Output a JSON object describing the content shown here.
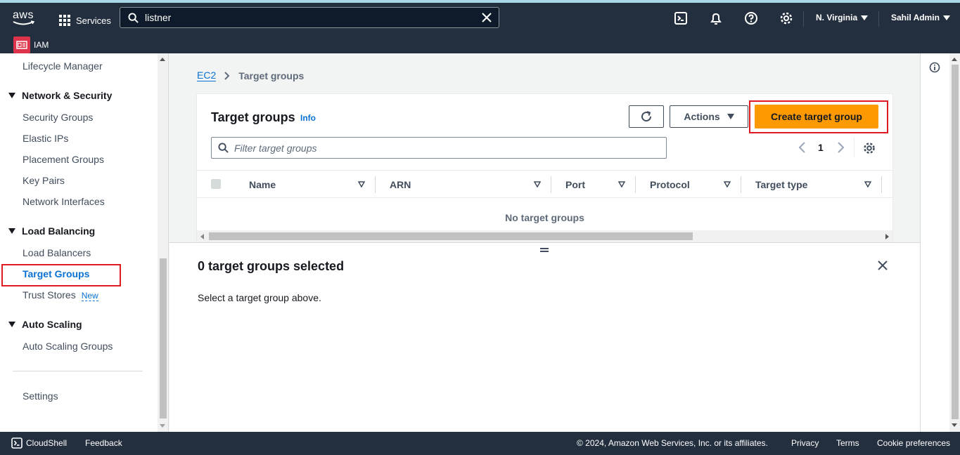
{
  "topbar": {
    "logo_text": "aws",
    "services_label": "Services",
    "search_value": "listner",
    "region_label": "N. Virginia",
    "user_label": "Sahil Admin",
    "pinned_service": "IAM"
  },
  "sidebar": {
    "items": [
      {
        "label": "Lifecycle Manager"
      },
      {
        "section": "Network & Security"
      },
      {
        "label": "Security Groups"
      },
      {
        "label": "Elastic IPs"
      },
      {
        "label": "Placement Groups"
      },
      {
        "label": "Key Pairs"
      },
      {
        "label": "Network Interfaces"
      },
      {
        "section": "Load Balancing"
      },
      {
        "label": "Load Balancers"
      },
      {
        "label": "Target Groups",
        "active": true
      },
      {
        "label": "Trust Stores",
        "badge": "New"
      },
      {
        "section": "Auto Scaling"
      },
      {
        "label": "Auto Scaling Groups"
      },
      {
        "label": "Settings"
      }
    ]
  },
  "breadcrumb": {
    "root": "EC2",
    "current": "Target groups"
  },
  "panel": {
    "title": "Target groups",
    "info": "Info",
    "actions_label": "Actions",
    "create_label": "Create target group",
    "filter_placeholder": "Filter target groups",
    "page_number": "1",
    "columns": [
      "Name",
      "ARN",
      "Port",
      "Protocol",
      "Target type"
    ],
    "empty_text": "No target groups"
  },
  "split_panel": {
    "title": "0 target groups selected",
    "body": "Select a target group above."
  },
  "footer": {
    "cloudshell": "CloudShell",
    "feedback": "Feedback",
    "copyright": "© 2024, Amazon Web Services, Inc. or its affiliates.",
    "privacy": "Privacy",
    "terms": "Terms",
    "cookies": "Cookie preferences"
  },
  "colors": {
    "nav_bg": "#232f3e",
    "primary_button": "#ff9900",
    "link": "#0972d3",
    "highlight_outline": "#e01a22"
  },
  "icons": [
    "grid-icon",
    "search-icon",
    "clear-icon",
    "cloudshell-icon",
    "bell-icon",
    "help-icon",
    "gear-icon",
    "refresh-icon",
    "chevron-right-icon",
    "chevron-left-icon",
    "sort-icon",
    "close-icon",
    "info-icon"
  ]
}
